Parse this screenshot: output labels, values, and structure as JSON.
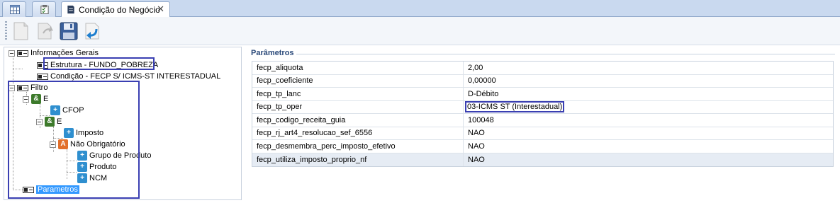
{
  "tabs": [
    {
      "name": "grid-tab",
      "icon": "table-icon"
    },
    {
      "name": "checklist-tab",
      "icon": "checklist-icon"
    },
    {
      "name": "condicao-tab",
      "icon": "document-icon",
      "title": "Condição do Negócio",
      "close": "✕"
    }
  ],
  "toolbar": {
    "buttons": [
      "new-icon",
      "redo-icon",
      "save-icon",
      "undo-icon"
    ]
  },
  "tree": {
    "info_gerais": "Informações Gerais",
    "estrutura": "Estrutura - FUNDO_POBREZA",
    "condicao": "Condição - FECP S/ ICMS-ST INTERESTADUAL",
    "filtro": "Filtro",
    "e1": "E",
    "cfop": "CFOP",
    "e2": "E",
    "imposto": "Imposto",
    "nao_obrigatorio": "Não Obrigatório",
    "grupo_produto": "Grupo de Produto",
    "produto": "Produto",
    "ncm": "NCM",
    "parametros": "Parametros"
  },
  "params": {
    "title": "Parâmetros",
    "rows": [
      {
        "key": "fecp_aliquota",
        "value": "2,00"
      },
      {
        "key": "fecp_coeficiente",
        "value": "0,00000"
      },
      {
        "key": "fecp_tp_lanc",
        "value": "D-Débito"
      },
      {
        "key": "fecp_tp_oper",
        "value": "03-ICMS ST (Interestadual)"
      },
      {
        "key": "fecp_codigo_receita_guia",
        "value": "100048"
      },
      {
        "key": "fecp_rj_art4_resolucao_sef_6556",
        "value": "NAO"
      },
      {
        "key": "fecp_desmembra_perc_imposto_efetivo",
        "value": "NAO"
      },
      {
        "key": "fecp_utiliza_imposto_proprio_nf",
        "value": "NAO"
      }
    ]
  },
  "colors": {
    "accent": "#3399ff",
    "highlight_box": "#3a3fb2",
    "tab_strip": "#c9d9ef"
  }
}
